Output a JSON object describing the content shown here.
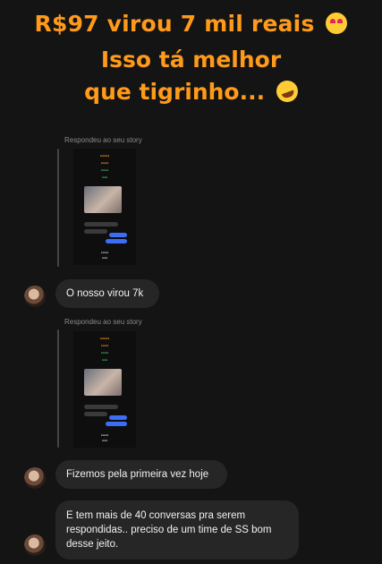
{
  "headline": {
    "line1": "R$97 virou 7 mil reais",
    "line2": "Isso tá melhor",
    "line3": "que tigrinho...",
    "emoji1": "heart-eyes-emoji",
    "emoji2": "rolling-laughing-emoji"
  },
  "colors": {
    "headline": "#ff9a1a",
    "background": "#141414",
    "bubble": "#262626",
    "story_label": "#8a8a8a"
  },
  "replies": [
    {
      "label": "Respondeu ao seu story"
    },
    {
      "label": "Respondeu ao seu story"
    }
  ],
  "messages": [
    {
      "text": "O nosso virou 7k"
    },
    {
      "text": "Fizemos pela primeira vez hoje"
    },
    {
      "text": "E tem mais de 40 conversas pra serem respondidas.. preciso de um time de SS bom desse jeito."
    }
  ]
}
